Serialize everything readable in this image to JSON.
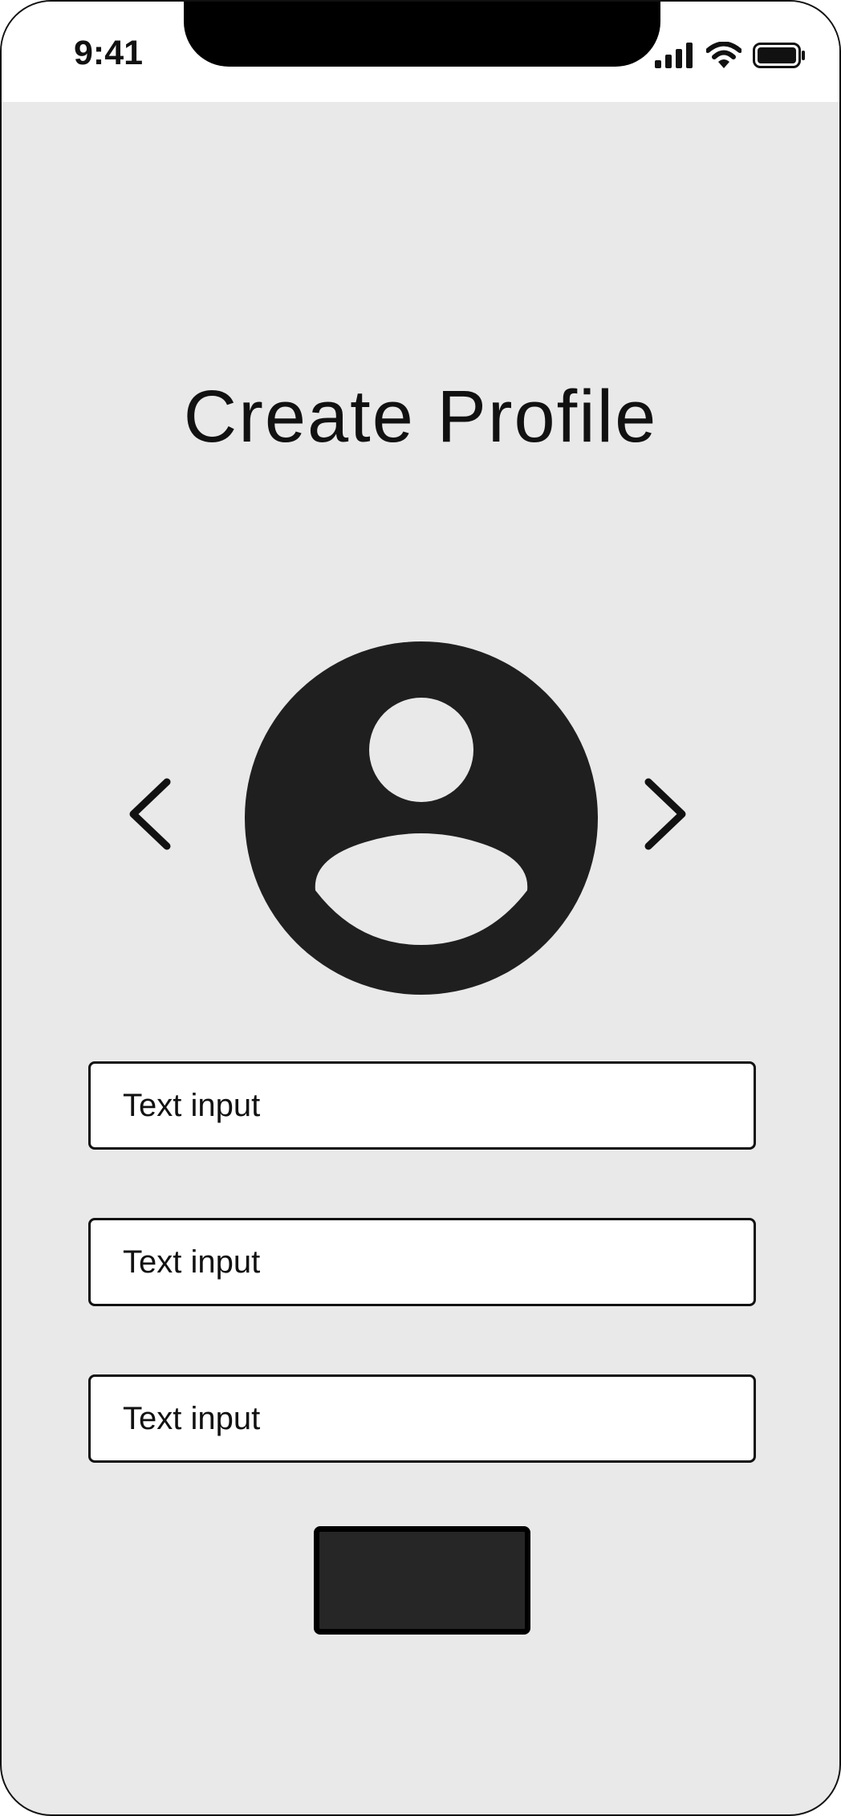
{
  "status_bar": {
    "time": "9:41",
    "icons": [
      "signal-icon",
      "wifi-icon",
      "battery-icon"
    ]
  },
  "page": {
    "title": "Create Profile"
  },
  "avatar": {
    "icon": "user-avatar-icon",
    "prev_icon": "chevron-left-icon",
    "next_icon": "chevron-right-icon"
  },
  "form": {
    "inputs": [
      {
        "placeholder": "Text input",
        "value": ""
      },
      {
        "placeholder": "Text input",
        "value": ""
      },
      {
        "placeholder": "Text input",
        "value": ""
      }
    ],
    "submit_label": ""
  },
  "colors": {
    "background": "#e9e9e9",
    "status_bar": "#ffffff",
    "avatar_fill": "#1f1f1f",
    "button_fill": "#262626",
    "border": "#111111"
  }
}
